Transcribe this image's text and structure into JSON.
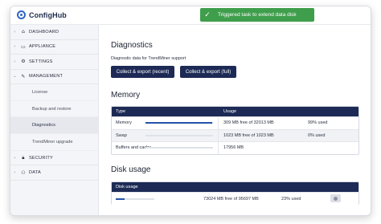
{
  "app": {
    "name": "ConfigHub"
  },
  "toast": {
    "icon": "check-icon",
    "message": "Triggered task to extend data disk",
    "color": "#3f9e4c"
  },
  "sidebar": {
    "items": [
      {
        "label": "DASHBOARD",
        "icon": "home-icon"
      },
      {
        "label": "APPLIANCE",
        "icon": "monitor-icon"
      },
      {
        "label": "SETTINGS",
        "icon": "gear-icon"
      },
      {
        "label": "MANAGEMENT",
        "icon": "wrench-icon",
        "expanded": true,
        "children": [
          "License",
          "Backup and restore",
          "Diagnostics",
          "TrendMiner upgrade"
        ],
        "active_child": "Diagnostics"
      },
      {
        "label": "SECURITY",
        "icon": "lock-icon"
      },
      {
        "label": "DATA",
        "icon": "network-icon"
      }
    ]
  },
  "diagnostics": {
    "title": "Diagnostics",
    "description": "Diagnostic data for TrendMiner support",
    "export_recent_label": "Collect & export (recent)",
    "export_full_label": "Collect & export (full)"
  },
  "memory": {
    "title": "Memory",
    "headers": [
      "Type",
      "Usage"
    ],
    "rows": [
      {
        "type": "Memory",
        "usage": "309 MB free of 32013 MB",
        "percent": "99% used",
        "fill": 0.99
      },
      {
        "type": "Swap",
        "usage": "1023 MB free of 1023 MB",
        "percent": "0% used",
        "fill": 0.0
      },
      {
        "type": "Buffers and cache",
        "usage": "17956 MB",
        "percent": "",
        "fill": 0.0
      }
    ]
  },
  "disk": {
    "title": "Disk usage",
    "header": "Disk usage",
    "rows": [
      {
        "usage": "73024 MB free of 95697 MB",
        "percent": "23% used",
        "fill": 0.23,
        "action_icon": "extend-disk-icon"
      }
    ]
  },
  "colors": {
    "accent": "#1c2a55",
    "bar": "#2453a8",
    "success": "#3f9e4c"
  }
}
